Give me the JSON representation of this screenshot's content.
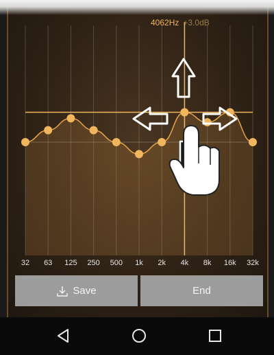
{
  "readout": {
    "frequency": "4062Hz",
    "gain": "+3.0dB"
  },
  "chart_data": {
    "type": "line",
    "title": "",
    "xlabel": "",
    "ylabel": "",
    "categories": [
      "32",
      "63",
      "125",
      "250",
      "500",
      "1k",
      "2k",
      "4k",
      "8k",
      "16k",
      "32k"
    ],
    "series": [
      {
        "values": [
          0,
          1.2,
          2.4,
          1.2,
          0,
          -1.2,
          0,
          3.0,
          2.0,
          3.0,
          0
        ]
      }
    ],
    "ylim": [
      -12,
      12
    ],
    "grid": true,
    "selected_band_index": 7
  },
  "actions": {
    "save_label": "Save",
    "end_label": "End"
  },
  "navbar": {
    "back": "back-icon",
    "home": "home-icon",
    "recents": "recents-icon"
  },
  "colors": {
    "accent": "#f0b55d",
    "curve": "#e8a24a",
    "button": "#9c9c9c",
    "navbar": "#0a0a0a"
  }
}
